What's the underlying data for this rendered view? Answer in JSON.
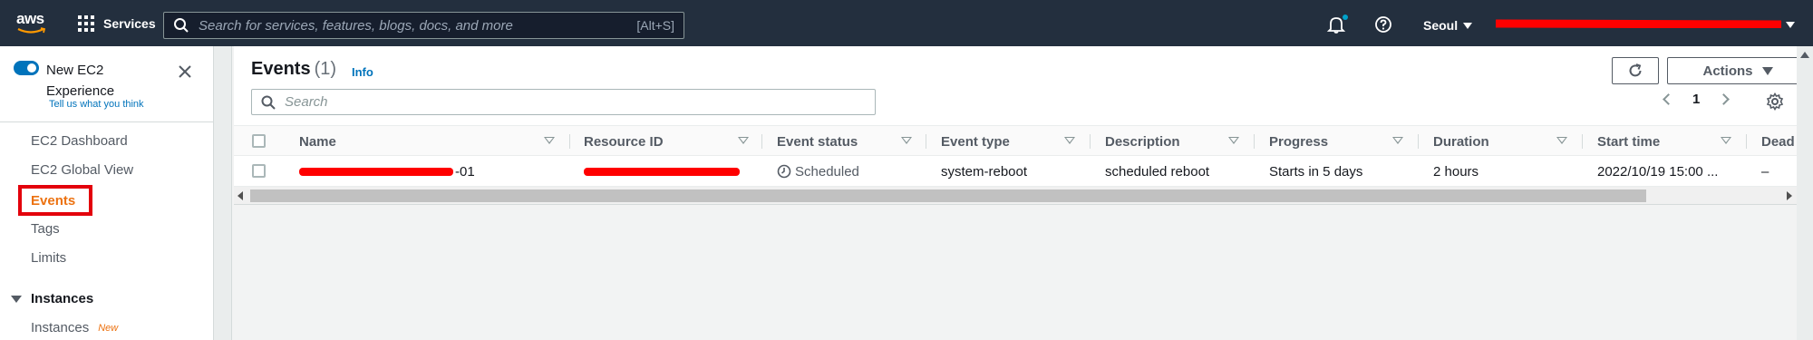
{
  "topnav": {
    "logo_text": "aws",
    "services_label": "Services",
    "search_placeholder": "Search for services, features, blogs, docs, and more",
    "search_shortcut": "[Alt+S]",
    "region": "Seoul",
    "colors": {
      "bg": "#232f3e",
      "accent": "#ff9900",
      "notify_dot": "#00a1c9"
    }
  },
  "sidebar": {
    "new_experience_line1": "New EC2",
    "new_experience_line2": "Experience",
    "feedback_link": "Tell us what you think",
    "items": [
      {
        "label": "EC2 Dashboard"
      },
      {
        "label": "EC2 Global View"
      },
      {
        "label": "Events",
        "active": true
      },
      {
        "label": "Tags"
      },
      {
        "label": "Limits"
      }
    ],
    "section": {
      "label": "Instances",
      "items": [
        {
          "label": "Instances",
          "badge": "New"
        }
      ]
    }
  },
  "main": {
    "title": "Events",
    "count": "(1)",
    "info_link": "Info",
    "refresh_icon": "refresh-icon",
    "actions_label": "Actions",
    "search_placeholder": "Search",
    "page_number": "1",
    "columns": [
      "Name",
      "Resource ID",
      "Event status",
      "Event type",
      "Description",
      "Progress",
      "Duration",
      "Start time",
      "Dead"
    ],
    "rows": [
      {
        "name_suffix": "-01",
        "event_status": "Scheduled",
        "event_type": "system-reboot",
        "description": "scheduled reboot",
        "progress": "Starts in 5 days",
        "duration": "2 hours",
        "start_time": "2022/10/19 15:00 ...",
        "deadline": "–"
      }
    ],
    "colors": {
      "link": "#0073bb",
      "active_nav": "#ec7211",
      "highlight_box": "#e3000b",
      "redaction": "#ff0000"
    }
  }
}
